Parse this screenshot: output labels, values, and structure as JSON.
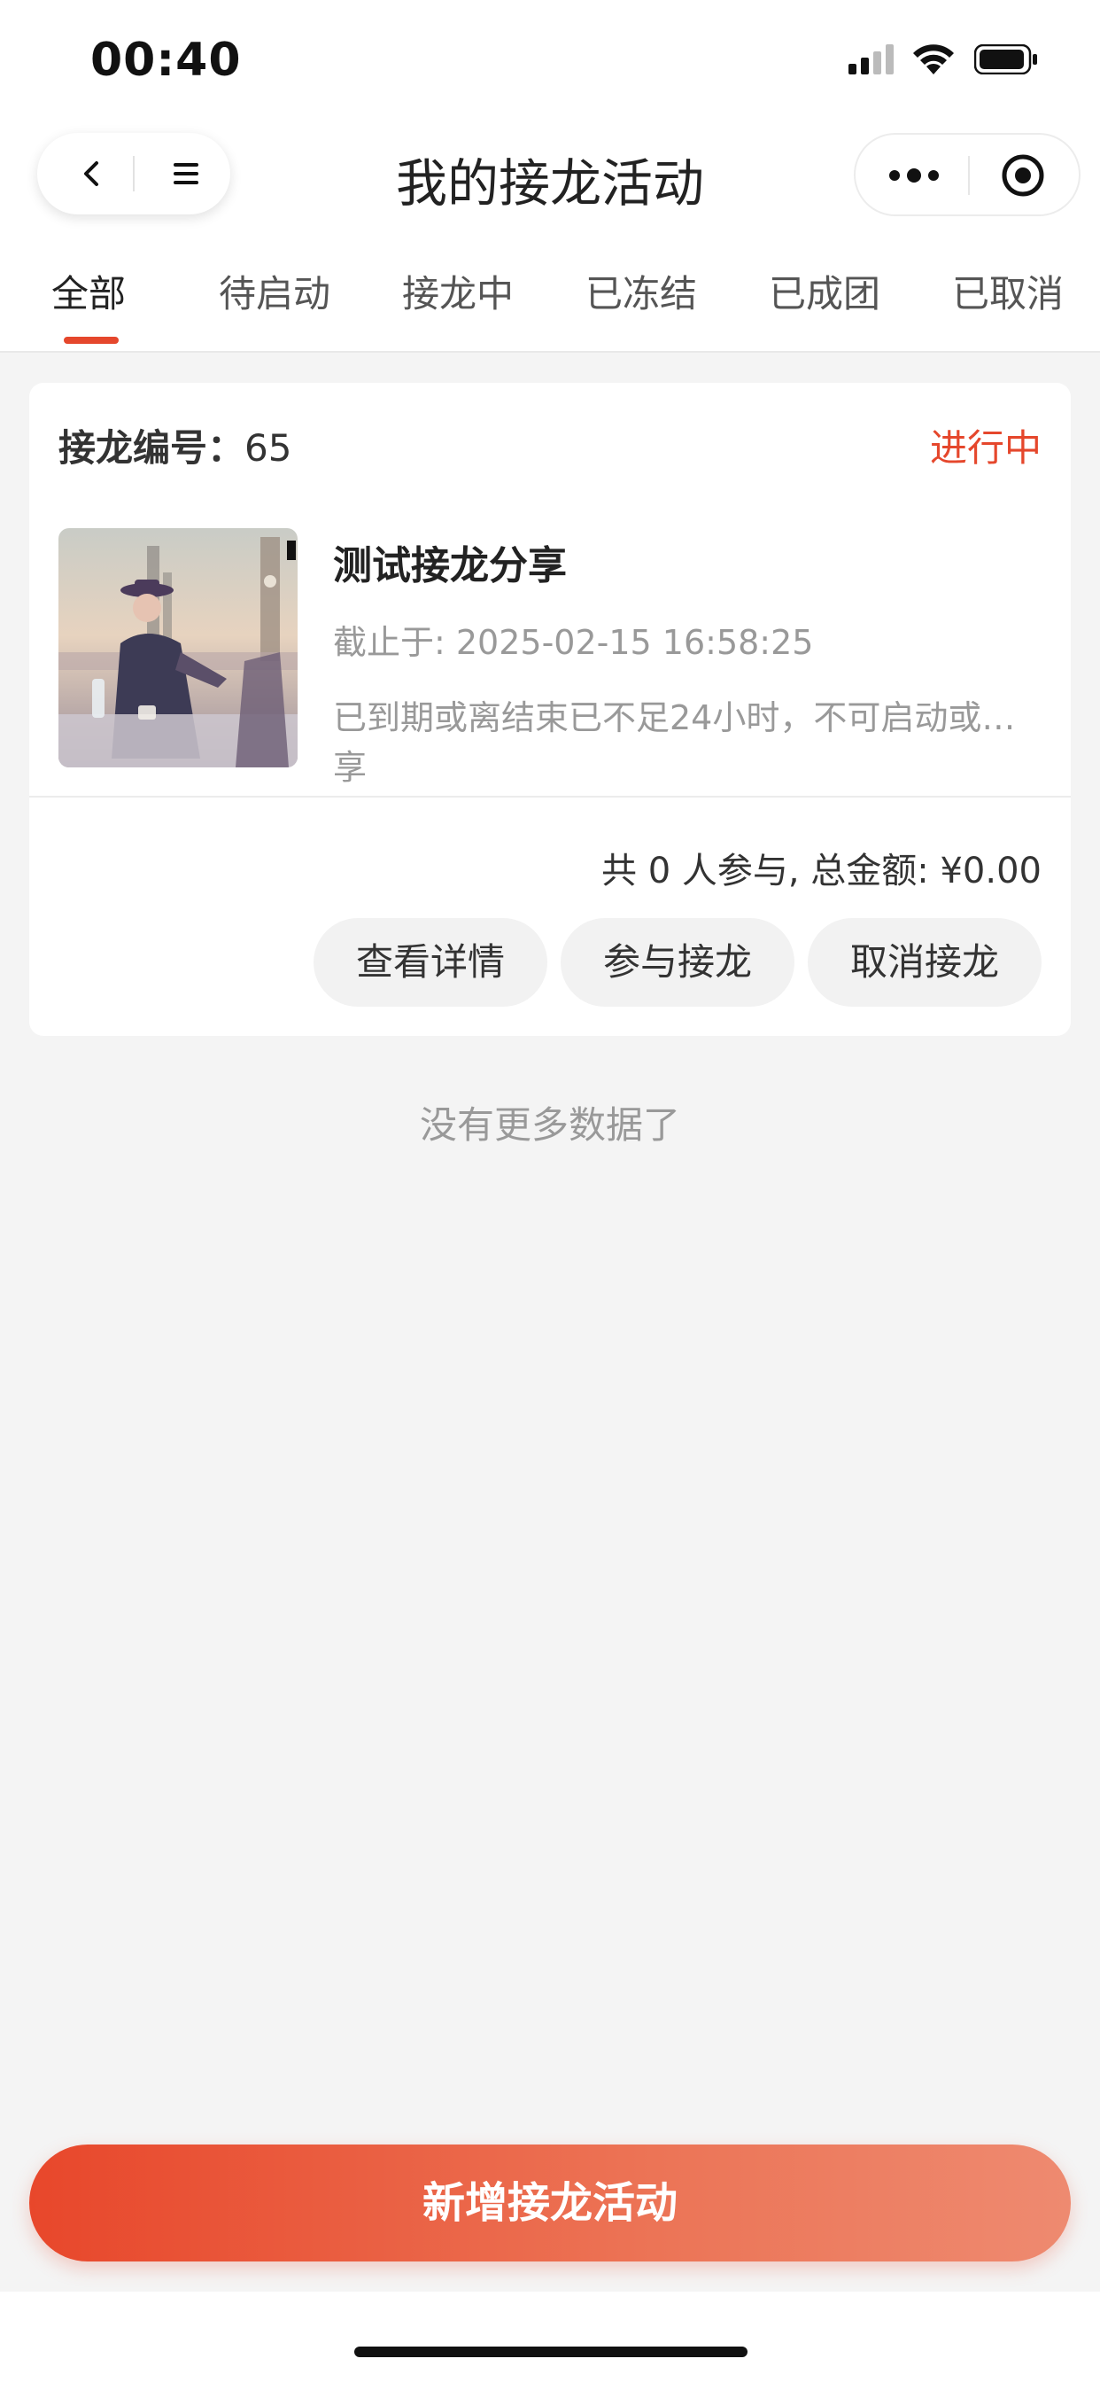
{
  "status_bar": {
    "time": "00:40"
  },
  "nav": {
    "title": "我的接龙活动"
  },
  "tabs": [
    {
      "label": "全部",
      "active": true
    },
    {
      "label": "待启动",
      "active": false
    },
    {
      "label": "接龙中",
      "active": false
    },
    {
      "label": "已冻结",
      "active": false
    },
    {
      "label": "已成团",
      "active": false
    },
    {
      "label": "已取消",
      "active": false
    }
  ],
  "card": {
    "order_prefix": "接龙编号：",
    "order_number": "65",
    "status": "进行中",
    "title": "测试接龙分享",
    "deadline": "截止于: 2025-02-15 16:58:25",
    "description": "已到期或离结束已不足24小时，不可启动或…享",
    "summary": "共 0 人参与, 总金额: ¥0.00",
    "buttons": {
      "detail": "查看详情",
      "join": "参与接龙",
      "cancel": "取消接龙"
    }
  },
  "list_footer": "没有更多数据了",
  "bottom_button": "新增接龙活动",
  "colors": {
    "accent": "#e5472c",
    "background": "#f4f4f4"
  }
}
